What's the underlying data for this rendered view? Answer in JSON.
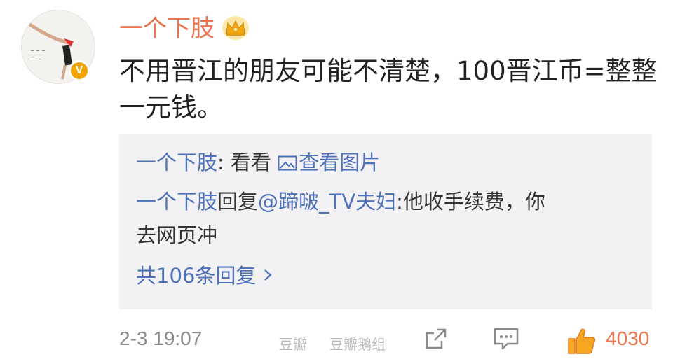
{
  "post": {
    "username": "一个下肢",
    "text": "不用晋江的朋友可能不清楚，100晋江币=整整一元钱。"
  },
  "quote": {
    "line1": {
      "name": "一个下肢",
      "text": ": 看看 ",
      "link": "查看图片"
    },
    "line2": {
      "name": "一个下肢",
      "reply": "回复",
      "mention": "@蹄啵_TV夫妇",
      "text": ":他收手续费，你"
    },
    "line3": {
      "text": "去网页冲"
    },
    "more": "共106条回复"
  },
  "footer": {
    "timestamp": "2-3 19:07",
    "watermark1": "豆瓣",
    "watermark2": "豆瓣鹅组",
    "likes": "4030"
  },
  "icons": [
    "crown-icon",
    "verified-badge-icon",
    "image-icon",
    "chevron-right-icon",
    "share-icon",
    "comment-icon",
    "thumbs-up-icon"
  ],
  "colors": {
    "accent": "#eb7350",
    "link": "#4e70b8",
    "verified": "#f4a400",
    "quote_bg": "#f2f2f5"
  }
}
